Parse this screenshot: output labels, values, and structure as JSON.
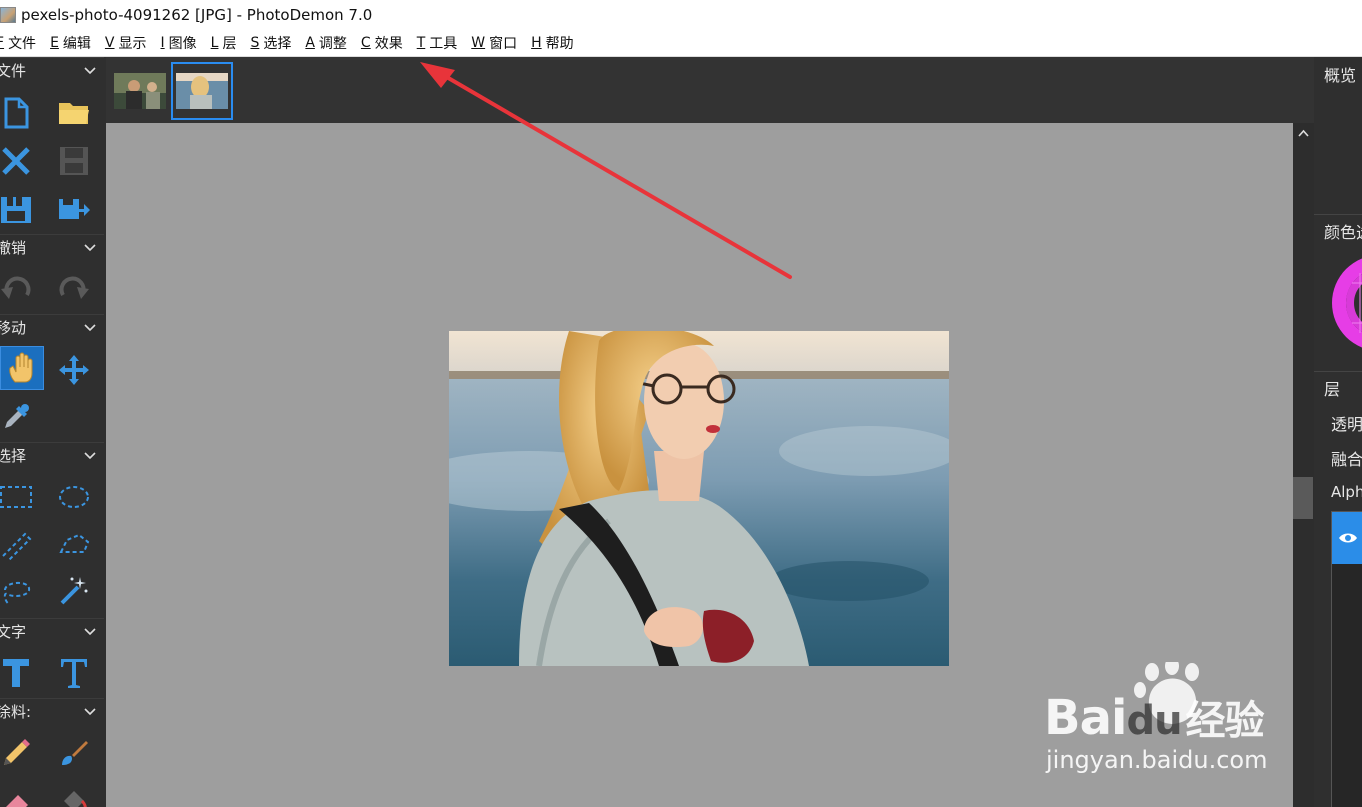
{
  "titlebar": {
    "title": "pexels-photo-4091262 [JPG]  -  PhotoDemon 7.0",
    "icon": "photo-thumbnail-icon"
  },
  "menubar": {
    "items": [
      {
        "key": "F",
        "label": "文件"
      },
      {
        "key": "E",
        "label": "编辑"
      },
      {
        "key": "V",
        "label": "显示"
      },
      {
        "key": "I",
        "label": "图像"
      },
      {
        "key": "L",
        "label": "层"
      },
      {
        "key": "S",
        "label": "选择"
      },
      {
        "key": "A",
        "label": "调整"
      },
      {
        "key": "C",
        "label": "效果"
      },
      {
        "key": "T",
        "label": "工具"
      },
      {
        "key": "W",
        "label": "窗口"
      },
      {
        "key": "H",
        "label": "帮助"
      }
    ]
  },
  "toolbox": {
    "sections": [
      {
        "label": "文件"
      },
      {
        "label": "撤销"
      },
      {
        "label": "移动"
      },
      {
        "label": "选择"
      },
      {
        "label": "文字"
      },
      {
        "label": "涂料:"
      }
    ],
    "tools": {
      "new": "new-file-icon",
      "open": "open-folder-icon",
      "close": "close-icon",
      "save": "save-icon",
      "save_as": "save-as-icon",
      "export": "export-icon",
      "undo": "undo-icon",
      "redo": "redo-icon",
      "hand": "hand-icon",
      "move": "move-icon",
      "eyedropper": "eyedropper-icon",
      "rect_select": "rectangle-select-icon",
      "ellipse_select": "ellipse-select-icon",
      "line_select": "line-select-icon",
      "polygon_select": "polygon-select-icon",
      "lasso_select": "lasso-select-icon",
      "magic_wand": "magic-wand-icon",
      "text_basic": "text-basic-icon",
      "text_advanced": "text-advanced-icon",
      "pencil": "pencil-icon",
      "brush": "brush-icon",
      "eraser": "eraser-icon",
      "fill": "fill-bucket-icon"
    }
  },
  "rightpanel": {
    "overview": "概览",
    "color": "颜色选",
    "layers": "层",
    "opacity": "透明",
    "blend": "融合",
    "alpha": "Alph"
  },
  "watermark": {
    "brand_latin": "Bai",
    "brand_mid": "du",
    "brand_cn": "经验",
    "url": "jingyan.baidu.com"
  },
  "colors": {
    "accent": "#2a8cf0",
    "annotation_arrow": "#e8343a",
    "canvas_bg": "#9e9e9e",
    "panel_bg": "#2f2f2f"
  }
}
